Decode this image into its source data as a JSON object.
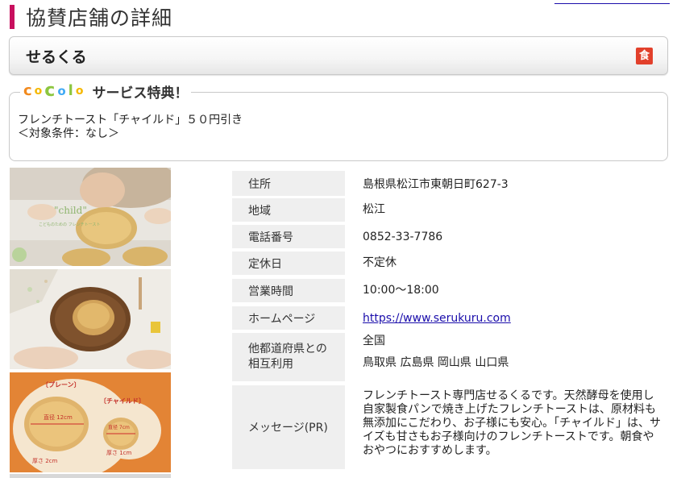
{
  "page": {
    "title": "協賛店舗の詳細"
  },
  "store": {
    "name": "せるくる",
    "category_icon": "食"
  },
  "service": {
    "logo_letters": [
      {
        "char": "c",
        "color": "#f28a1e"
      },
      {
        "char": "o",
        "color": "#f5b800"
      },
      {
        "char": "c",
        "color": "#8cc63f"
      },
      {
        "char": "o",
        "color": "#3fa9f5"
      },
      {
        "char": "l",
        "color": "#8cc63f"
      },
      {
        "char": "o",
        "color": "#f5b800"
      }
    ],
    "title": "サービス特典！",
    "line1": "フレンチトースト「チャイルド」５０円引き",
    "line2": "＜対象条件：なし＞"
  },
  "photos": {
    "photo1_caption_main": "\"child\"",
    "photo1_caption_sub": "こどものための フレンチトースト",
    "photo3_plain_label": "〔プレーン〕",
    "photo3_child_label": "〔チャイルド〕",
    "photo3_plain_diameter": "直径 12cm",
    "photo3_child_diameter": "直径 7cm",
    "photo3_plain_thickness": "厚さ 2cm",
    "photo3_child_thickness": "厚さ 1cm"
  },
  "info": {
    "address": {
      "label": "住所",
      "value": "島根県松江市東朝日町627-3"
    },
    "region": {
      "label": "地域",
      "value": "松江"
    },
    "phone": {
      "label": "電話番号",
      "value": "0852-33-7786"
    },
    "holiday": {
      "label": "定休日",
      "value": "不定休"
    },
    "hours": {
      "label": "営業時間",
      "value": "10:00～18:00"
    },
    "homepage": {
      "label": "ホームページ",
      "value": "https://www.serukuru.com"
    },
    "mutual": {
      "label_line1": "他都道府県との",
      "label_line2": "相互利用",
      "value_line1": "全国",
      "value_line2": "鳥取県 広島県 岡山県 山口県"
    },
    "message": {
      "label": "メッセージ(PR)",
      "value": "フレンチトースト専門店せるくるです。天然酵母を使用し自家製食パンで焼き上げたフレンチトーストは、原材料も無添加にこだわり、お子様にも安心。「チャイルド」は、サイズも甘さもお子様向けのフレンチトーストです。朝食やおやつにおすすめします。"
    }
  }
}
